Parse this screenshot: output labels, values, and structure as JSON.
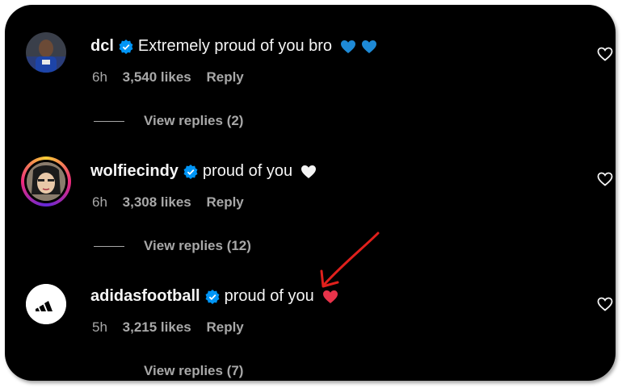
{
  "comments": [
    {
      "username": "dcl",
      "text": "Extremely proud of you bro",
      "emoji": "blue-heart-x2",
      "time": "6h",
      "likes": "3,540 likes",
      "reply_label": "Reply",
      "view_replies": "View replies (2)"
    },
    {
      "username": "wolfiecindy",
      "text": "proud of you",
      "emoji": "white-heart",
      "time": "6h",
      "likes": "3,308 likes",
      "reply_label": "Reply",
      "view_replies": "View replies (12)"
    },
    {
      "username": "adidasfootball",
      "text": "proud of you",
      "emoji": "red-heart",
      "time": "5h",
      "likes": "3,215 likes",
      "reply_label": "Reply",
      "view_replies": "View replies (7)"
    }
  ],
  "colors": {
    "background": "#000000",
    "text": "#f5f5f5",
    "secondary": "#a8a8a8",
    "verified": "#0095f6",
    "annotation_arrow": "#e0201c"
  }
}
